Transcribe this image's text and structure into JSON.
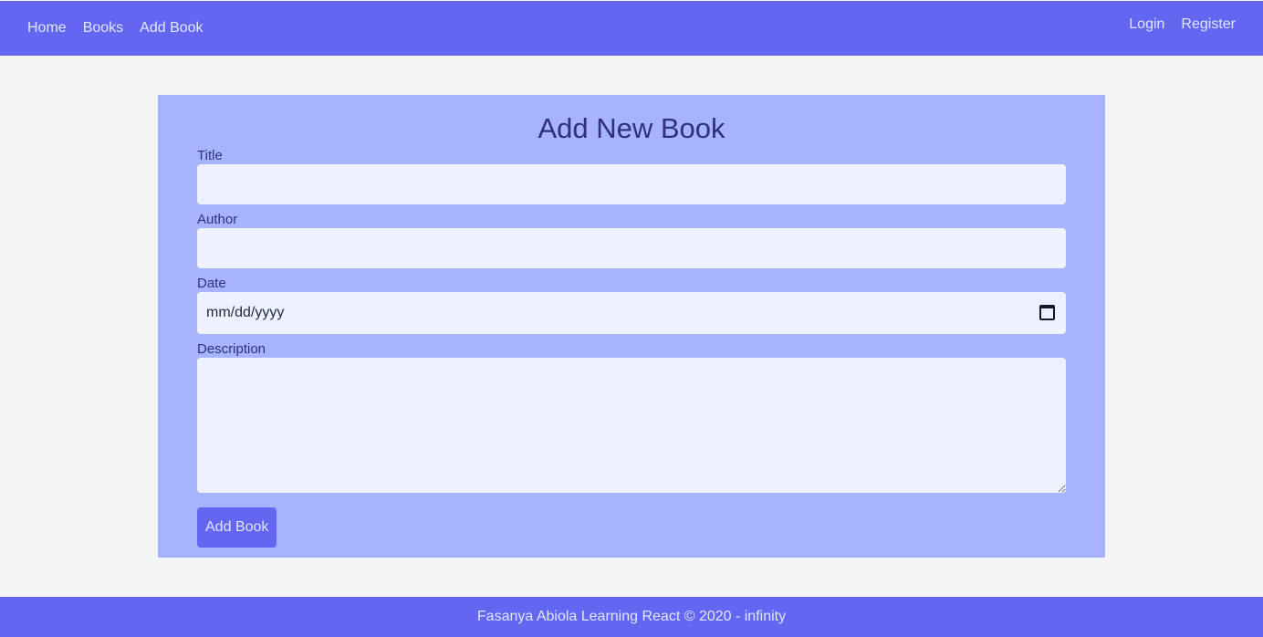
{
  "nav": {
    "home": "Home",
    "books": "Books",
    "add_book": "Add Book",
    "login": "Login",
    "register": "Register"
  },
  "form": {
    "heading": "Add New Book",
    "title_label": "Title",
    "title_value": "",
    "author_label": "Author",
    "author_value": "",
    "date_label": "Date",
    "date_placeholder": "mm/dd/yyyy",
    "description_label": "Description",
    "description_value": "",
    "submit_label": "Add Book"
  },
  "footer": {
    "text": "Fasanya Abiola Learning React © 2020 - infinity"
  },
  "colors": {
    "primary": "#6366f1",
    "card_bg": "#a5b4fc",
    "input_bg": "#eef2ff",
    "page_bg": "#f3f4f6",
    "heading": "#312e81"
  }
}
